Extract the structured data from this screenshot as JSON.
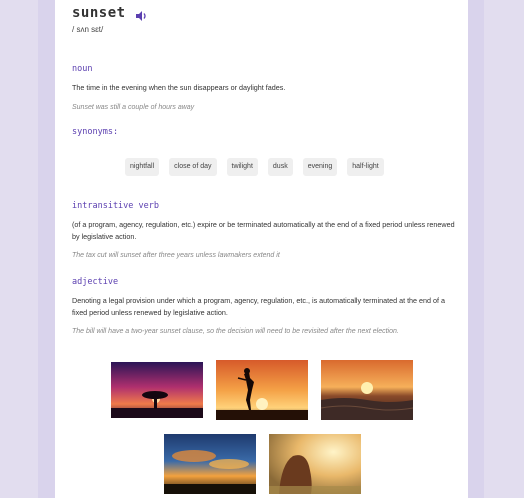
{
  "entry": {
    "word": "sunset",
    "phonetic": "/ sʌn sɛt/"
  },
  "noun": {
    "label": "noun",
    "definition": "The time in the evening when the sun disappears or daylight fades.",
    "example": "Sunset was still a couple of hours away"
  },
  "synonyms": {
    "label": "synonyms:",
    "items": [
      "nightfall",
      "close of day",
      "twilight",
      "dusk",
      "evening",
      "half-light"
    ]
  },
  "verb": {
    "label": "intransitive verb",
    "definition": "(of a program, agency, regulation, etc.) expire or be terminated automatically at the end of a fixed period unless renewed by legislative action.",
    "example": "The tax cut will sunset after three years unless lawmakers extend it"
  },
  "adjective": {
    "label": "adjective",
    "definition": "Denoting a legal provision under which a program, agency, regulation, etc., is automatically terminated at the end of a fixed period unless renewed by legislative action.",
    "example": "The bill will have a two-year sunset clause, so the decision will need to be revisited after the next election."
  },
  "images": [
    {
      "name": "tree-silhouette-sunset-photo"
    },
    {
      "name": "woman-silhouette-sunset-photo"
    },
    {
      "name": "ocean-sunset-photo"
    },
    {
      "name": "cloudy-sky-sunset-photo"
    },
    {
      "name": "girl-golden-hour-photo"
    }
  ],
  "icons": {
    "pronounce": "speaker-icon"
  },
  "colors": {
    "accent": "#5b3fb0",
    "background": "#e2ddef",
    "card": "#ffffff"
  }
}
